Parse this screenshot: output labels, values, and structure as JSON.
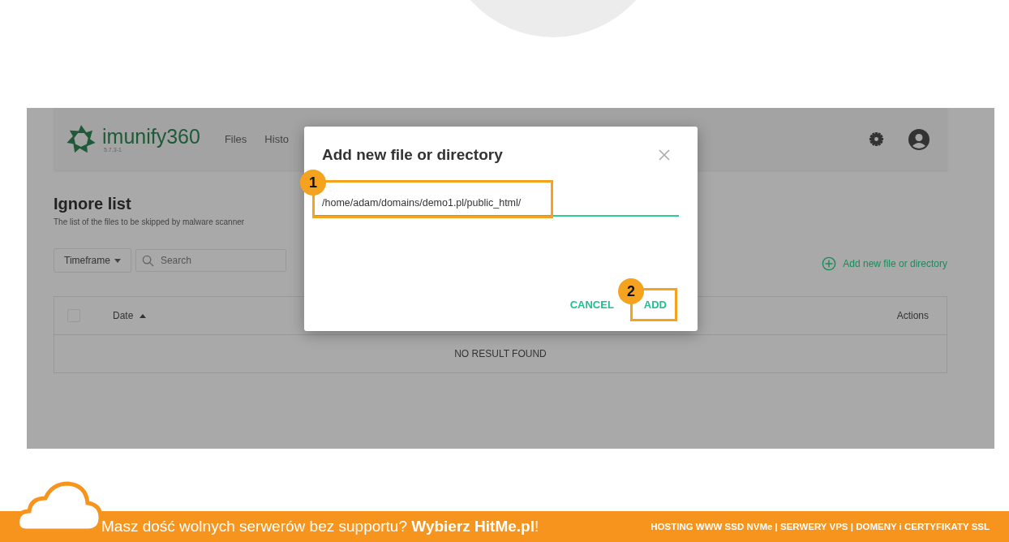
{
  "app": {
    "logo": {
      "name": "imunify360",
      "version": "5.7.3-1"
    },
    "nav": [
      "Files",
      "Histo"
    ],
    "page": {
      "title": "Ignore list",
      "subtitle": "The list of the files to be skipped by malware scanner"
    },
    "toolbar": {
      "timeframe": "Timeframe",
      "search_placeholder": "Search",
      "add_link": "Add new file or directory"
    },
    "table": {
      "select_all_checked": false,
      "columns": [
        {
          "label": "Date",
          "sorted": true
        },
        {
          "label": "Actions",
          "sorted": false
        }
      ],
      "empty_text": "NO RESULT FOUND"
    }
  },
  "dialog": {
    "title": "Add new file or directory",
    "value": "/home/adam/domains/demo1.pl/public_html/",
    "buttons": [
      "CANCEL",
      "ADD"
    ]
  },
  "annotations": [
    {
      "number": "1"
    },
    {
      "number": "2"
    }
  ],
  "banner": {
    "text": "Masz dość wolnych serwerów bez supportu? **Wybierz HitMe.pl**!",
    "services": "HOSTING WWW SSD NVMe | SERWERY VPS | DOMENY i CERTYFIKATY SSL"
  }
}
